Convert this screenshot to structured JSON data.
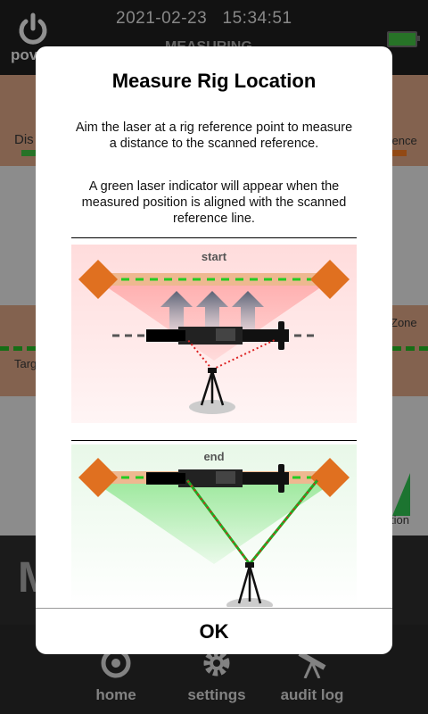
{
  "status_bar": {
    "date": "2021-02-23",
    "time": "15:34:51",
    "power_label": "pov",
    "page_title": "MEASURING"
  },
  "background": {
    "row1_left": "Dis",
    "row1_right": "erence",
    "row3_left": "Targ",
    "row3_right": "Zone",
    "row4_right": "tion",
    "big_label": "M"
  },
  "nav": {
    "items": [
      {
        "label": "home",
        "icon": "home-icon"
      },
      {
        "label": "settings",
        "icon": "gear-icon"
      },
      {
        "label": "audit log",
        "icon": "telescope-icon"
      }
    ]
  },
  "modal": {
    "title": "Measure Rig Location",
    "paragraph1": "Aim the laser at a rig reference point to measure a distance to the scanned reference.",
    "paragraph2": "A green laser indicator will appear when the measured position is aligned with the scanned reference line.",
    "start_label": "start",
    "end_label": "end",
    "ok_label": "OK"
  },
  "colors": {
    "accent_orange": "#e07020",
    "laser_green": "#22cc22",
    "laser_red": "#dd2222",
    "battery_green": "#3db13d"
  }
}
